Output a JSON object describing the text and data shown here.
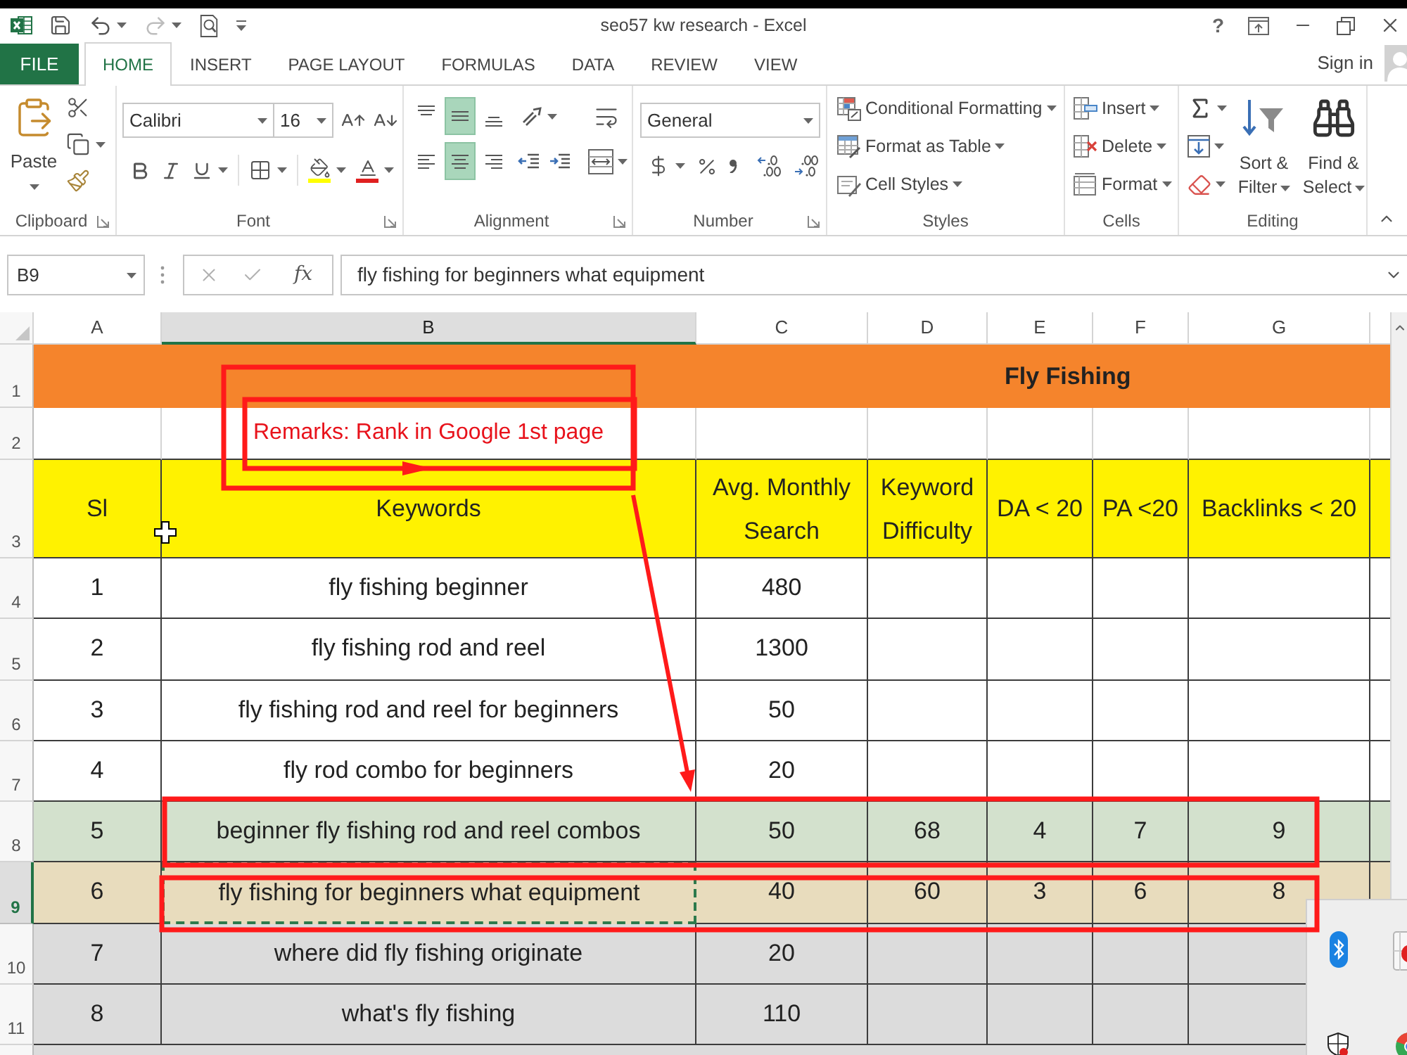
{
  "title_bar": {
    "title": "seo57 kw research - Excel",
    "help": "?"
  },
  "tabs": [
    {
      "label": "FILE",
      "kind": "file",
      "selected": false
    },
    {
      "label": "HOME",
      "kind": "tab",
      "selected": true
    },
    {
      "label": "INSERT",
      "kind": "tab",
      "selected": false
    },
    {
      "label": "PAGE LAYOUT",
      "kind": "tab",
      "selected": false
    },
    {
      "label": "FORMULAS",
      "kind": "tab",
      "selected": false
    },
    {
      "label": "DATA",
      "kind": "tab",
      "selected": false
    },
    {
      "label": "REVIEW",
      "kind": "tab",
      "selected": false
    },
    {
      "label": "VIEW",
      "kind": "tab",
      "selected": false
    }
  ],
  "account": {
    "label": "Sign in"
  },
  "ribbon": {
    "clipboard": {
      "paste": "Paste",
      "label": "Clipboard"
    },
    "font": {
      "name": "Calibri",
      "size": "16",
      "label": "Font"
    },
    "alignment": {
      "vertical": [
        {
          "selected": false
        },
        {
          "selected": true
        },
        {
          "selected": false
        }
      ],
      "horizontal": [
        {
          "selected": false
        },
        {
          "selected": true
        },
        {
          "selected": false
        }
      ],
      "label": "Alignment"
    },
    "number": {
      "format": "General",
      "label": "Number"
    },
    "styles": {
      "items": [
        "Conditional Formatting",
        "Format as Table",
        "Cell Styles"
      ],
      "label": "Styles"
    },
    "cells": {
      "items": [
        "Insert",
        "Delete",
        "Format"
      ],
      "label": "Cells"
    },
    "editing": {
      "buttons": [
        "Sort & Filter",
        "Find & Select"
      ],
      "label": "Editing"
    }
  },
  "formula_bar": {
    "name_box": "B9",
    "function_button": "fx",
    "formula": "fly fishing for beginners what equipment"
  },
  "sheet": {
    "columns": [
      {
        "label": "A",
        "selected": false
      },
      {
        "label": "B",
        "selected": true
      },
      {
        "label": "C",
        "selected": false
      },
      {
        "label": "D",
        "selected": false
      },
      {
        "label": "E",
        "selected": false
      },
      {
        "label": "F",
        "selected": false
      },
      {
        "label": "G",
        "selected": false
      }
    ],
    "rows": [
      {
        "number": "1",
        "kind": "title",
        "selected": false,
        "color": "#f5842c",
        "title": "Fly Fishing"
      },
      {
        "number": "2",
        "kind": "remark",
        "selected": false,
        "color": "#ffffff",
        "remark": "Remarks: Rank in Google 1st page"
      },
      {
        "number": "3",
        "kind": "header",
        "selected": false,
        "color": "#fff200",
        "cells": [
          "Sl",
          "Keywords",
          "Avg. Monthly Search",
          "Keyword Difficulty",
          "DA < 20",
          "PA <20",
          "Backlinks < 20"
        ]
      },
      {
        "number": "4",
        "kind": "data",
        "selected": false,
        "color": "#ffffff",
        "cells": [
          "1",
          "fly fishing beginner",
          "480"
        ]
      },
      {
        "number": "5",
        "kind": "data",
        "selected": false,
        "color": "#ffffff",
        "cells": [
          "2",
          "fly fishing rod and reel",
          "1300"
        ]
      },
      {
        "number": "6",
        "kind": "data",
        "selected": false,
        "color": "#ffffff",
        "cells": [
          "3",
          "fly fishing rod and reel for beginners",
          "50"
        ]
      },
      {
        "number": "7",
        "kind": "data",
        "selected": false,
        "color": "#ffffff",
        "cells": [
          "4",
          "fly rod combo for beginners",
          "20"
        ]
      },
      {
        "number": "8",
        "kind": "data",
        "selected": false,
        "color": "#d3e1cd",
        "cells": [
          "5",
          "beginner fly fishing rod and reel combos",
          "50",
          "68",
          "4",
          "7",
          "9"
        ]
      },
      {
        "number": "9",
        "kind": "data",
        "selected": true,
        "color": "#e8dcbd",
        "cells": [
          "6",
          "fly fishing for beginners what equipment",
          "40",
          "60",
          "3",
          "6",
          "8"
        ]
      },
      {
        "number": "10",
        "kind": "data",
        "selected": false,
        "color": "#dcdcdc",
        "cells": [
          "7",
          "where did fly fishing originate",
          "20"
        ]
      },
      {
        "number": "11",
        "kind": "data",
        "selected": false,
        "color": "#dcdcdc",
        "cells": [
          "8",
          "what's fly fishing",
          "110"
        ]
      }
    ]
  }
}
